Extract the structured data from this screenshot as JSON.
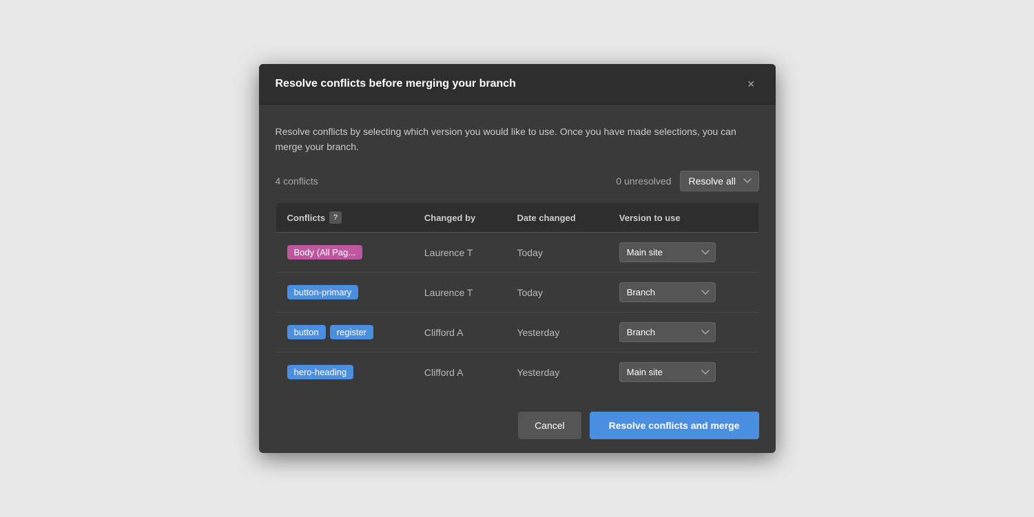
{
  "modal": {
    "title": "Resolve conflicts before merging your branch",
    "close_label": "×",
    "description": "Resolve conflicts by selecting which version you would like to use. Once you have made selections, you can merge your branch.",
    "conflicts_count": "4 conflicts",
    "unresolved_count": "0 unresolved",
    "resolve_all_label": "Resolve all",
    "table": {
      "headers": {
        "conflicts": "Conflicts",
        "help": "?",
        "changed_by": "Changed by",
        "date_changed": "Date changed",
        "version_to_use": "Version to use"
      },
      "rows": [
        {
          "tags": [
            {
              "label": "Body (All Pag...",
              "color": "pink"
            }
          ],
          "changed_by": "Laurence T",
          "date_changed": "Today",
          "version": "Main site",
          "version_options": [
            "Main site",
            "Branch"
          ]
        },
        {
          "tags": [
            {
              "label": "button-primary",
              "color": "blue"
            }
          ],
          "changed_by": "Laurence T",
          "date_changed": "Today",
          "version": "Branch",
          "version_options": [
            "Main site",
            "Branch"
          ]
        },
        {
          "tags": [
            {
              "label": "button",
              "color": "blue"
            },
            {
              "label": "register",
              "color": "blue"
            }
          ],
          "changed_by": "Clifford A",
          "date_changed": "Yesterday",
          "version": "Branch",
          "version_options": [
            "Main site",
            "Branch"
          ]
        },
        {
          "tags": [
            {
              "label": "hero-heading",
              "color": "blue"
            }
          ],
          "changed_by": "Clifford A",
          "date_changed": "Yesterday",
          "version": "Main site",
          "version_options": [
            "Main site",
            "Branch"
          ]
        }
      ]
    },
    "footer": {
      "cancel_label": "Cancel",
      "resolve_label": "Resolve conflicts and merge"
    }
  }
}
